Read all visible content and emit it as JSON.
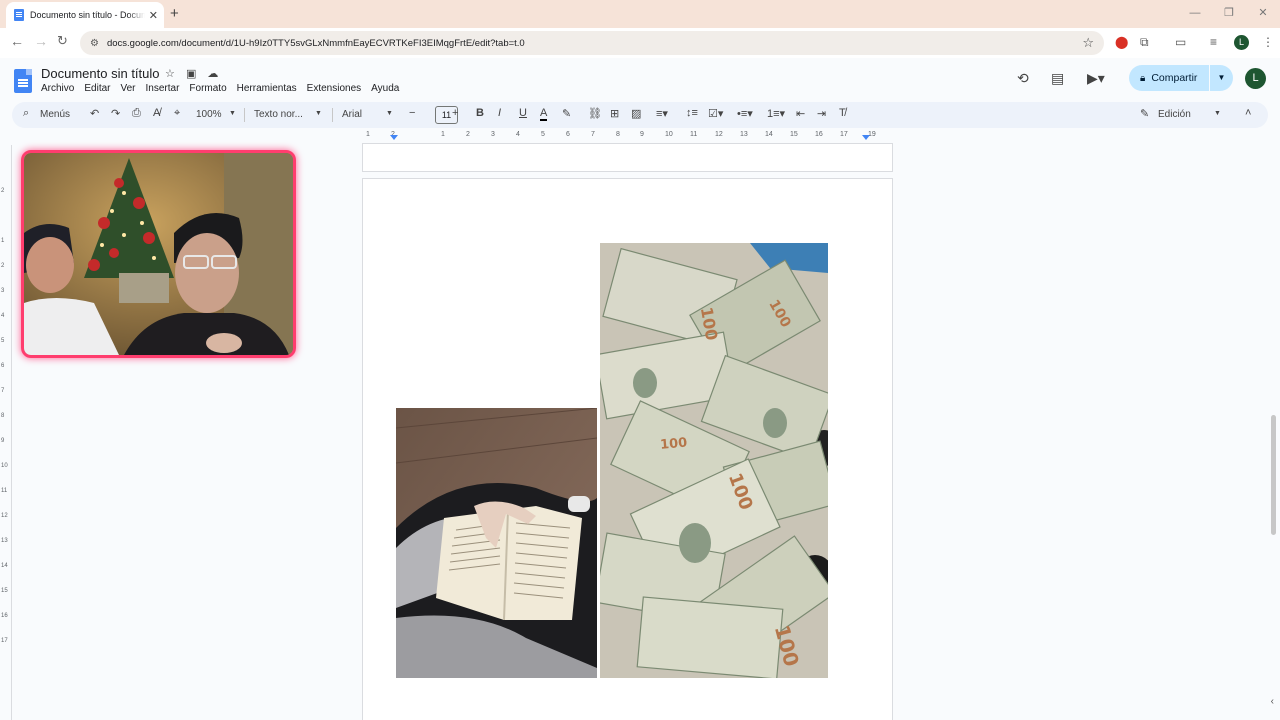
{
  "browser": {
    "tab_title": "Documento sin título - Docume",
    "url": "docs.google.com/document/d/1U-h9Iz0TTY5svGLxNmmfnEayECVRTKeFI3EIMqgFrtE/edit?tab=t.0",
    "profile_initial": "L"
  },
  "doc": {
    "title": "Documento sin título",
    "menu": [
      "Archivo",
      "Editar",
      "Ver",
      "Insertar",
      "Formato",
      "Herramientas",
      "Extensiones",
      "Ayuda"
    ],
    "share_label": "Compartir",
    "account_initial": "L"
  },
  "toolbar": {
    "search_label": "Menús",
    "zoom": "100%",
    "style": "Texto nor...",
    "font": "Arial",
    "font_size": "11",
    "mode": "Edición"
  },
  "ruler": {
    "ticks": [
      "1",
      "2",
      "1",
      "2",
      "3",
      "4",
      "5",
      "6",
      "7",
      "8",
      "9",
      "10",
      "11",
      "12",
      "13",
      "14",
      "15",
      "16",
      "17",
      "18",
      "19"
    ]
  },
  "vruler": {
    "ticks": [
      "2",
      "1",
      "1",
      "2",
      "3",
      "4",
      "5",
      "6",
      "7",
      "8",
      "9",
      "10",
      "11",
      "12",
      "13",
      "14",
      "15",
      "16",
      "17"
    ]
  },
  "colors": {
    "accent": "#4285f4",
    "share_bg": "#c2e7ff",
    "cam_border": "#ff3d6e",
    "tabstrip": "#f6e3d8"
  }
}
